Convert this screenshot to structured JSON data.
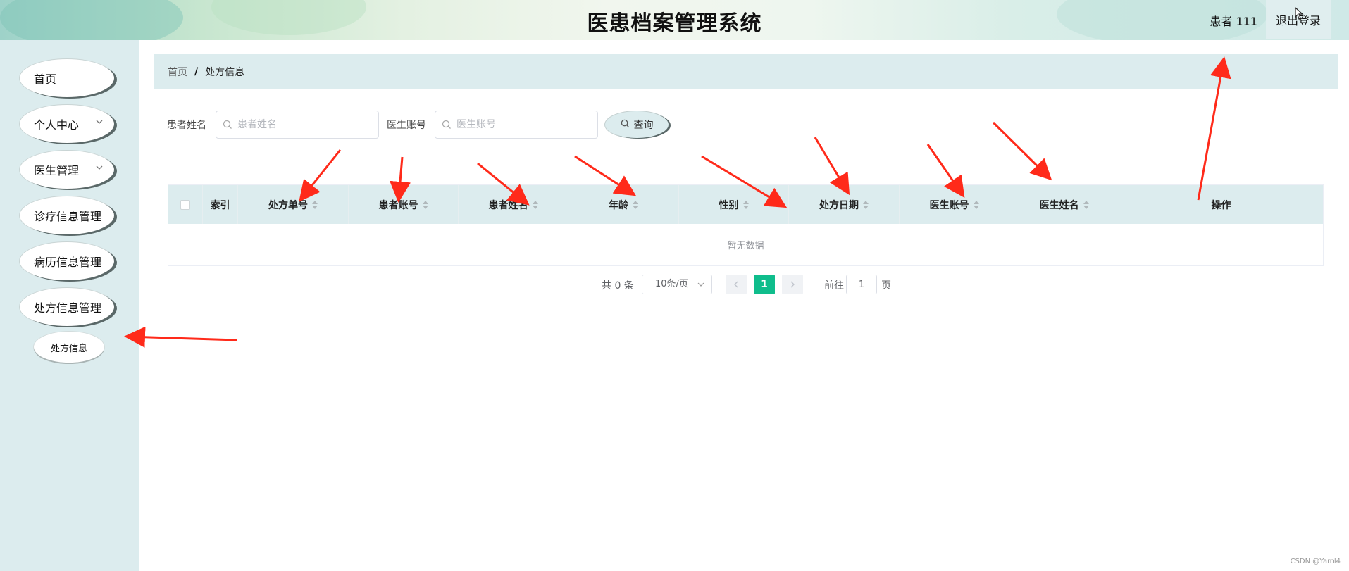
{
  "header": {
    "title": "医患档案管理系统",
    "user_label": "患者 111",
    "logout_label": "退出登录"
  },
  "sidebar": {
    "items": [
      {
        "label": "首页"
      },
      {
        "label": "个人中心"
      },
      {
        "label": "医生管理"
      },
      {
        "label": "诊疗信息管理"
      },
      {
        "label": "病历信息管理"
      },
      {
        "label": "处方信息管理"
      }
    ],
    "sub_item": "处方信息"
  },
  "breadcrumb": {
    "home": "首页",
    "separator": "/",
    "current": "处方信息"
  },
  "search": {
    "patient_name_label": "患者姓名",
    "patient_name_placeholder": "患者姓名",
    "doctor_account_label": "医生账号",
    "doctor_account_placeholder": "医生账号",
    "query_label": "查询"
  },
  "table": {
    "columns": [
      "索引",
      "处方单号",
      "患者账号",
      "患者姓名",
      "年龄",
      "性别",
      "处方日期",
      "医生账号",
      "医生姓名",
      "操作"
    ],
    "empty_text": "暂无数据"
  },
  "pagination": {
    "total_text": "共 0 条",
    "page_size": "10条/页",
    "current_page": "1",
    "goto_label": "前往",
    "goto_value": "1",
    "page_unit": "页"
  },
  "watermark": "CSDN @Yaml4",
  "colors": {
    "accent": "#0fbd8c",
    "panel": "#dcecee",
    "annotation": "#ff2a1a"
  }
}
